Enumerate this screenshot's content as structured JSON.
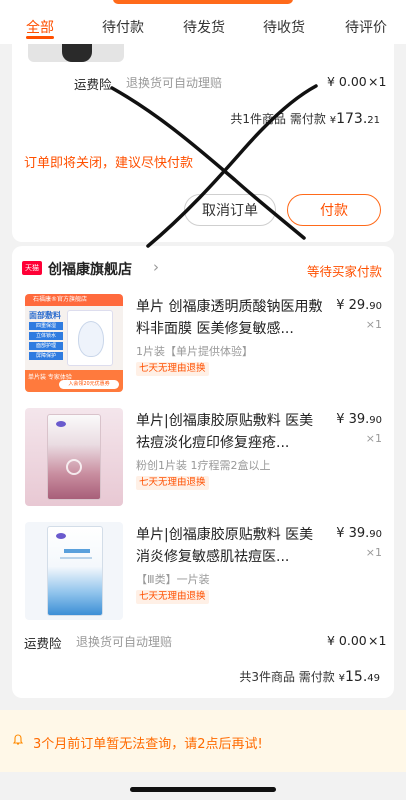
{
  "tabs": [
    {
      "label": "全部",
      "active": true
    },
    {
      "label": "待付款",
      "active": false
    },
    {
      "label": "待发货",
      "active": false
    },
    {
      "label": "待收货",
      "active": false
    },
    {
      "label": "待评价",
      "active": false
    }
  ],
  "order1": {
    "shipping_label": "运费险",
    "shipping_desc": "退换货可自动理赔",
    "shipping_price": "¥ 0.00",
    "shipping_qty": "×1",
    "summary_count": "共1件商品",
    "summary_pay_label": "需付款",
    "summary_currency": "¥",
    "summary_int": "173.",
    "summary_dec": "21",
    "notice": "订单即将关闭，建议尽快付款",
    "cancel_label": "取消订单",
    "pay_label": "付款"
  },
  "order2": {
    "store_badge": "天猫",
    "store_name": "创福康旗舰店",
    "store_status": "等待买家付款",
    "items": [
      {
        "title": "单片 创福康透明质酸钠医用敷料非面膜 医美修复敏感...",
        "sku": "1片装【单片提供体验】",
        "tag": "七天无理由退换",
        "price_int": "¥ 29.",
        "price_dec": "90",
        "qty": "×1",
        "img_band": "石福康®官方旗舰店",
        "img_title": "面部敷料",
        "img_lines": [
          "四重保湿",
          "立体锁水",
          "面部护理",
          "屏障保护"
        ],
        "img_bottom1": "单片装 专家体验",
        "img_bottom2": "入会领20元优惠券"
      },
      {
        "title": "单片|创福康胶原贴敷料 医美祛痘淡化痘印修复痤疮...",
        "sku": "粉创1片装 1疗程需2盒以上",
        "tag": "七天无理由退换",
        "price_int": "¥ 39.",
        "price_dec": "90",
        "qty": "×1"
      },
      {
        "title": "单片|创福康胶原贴敷料 医美消炎修复敏感肌祛痘医...",
        "sku": "【Ⅲ类】一片装",
        "tag": "七天无理由退换",
        "price_int": "¥ 39.",
        "price_dec": "90",
        "qty": "×1"
      }
    ],
    "shipping_label": "运费险",
    "shipping_desc": "退换货可自动理赔",
    "shipping_price": "¥ 0.00",
    "shipping_qty": "×1",
    "summary_count": "共3件商品",
    "summary_pay_label": "需付款",
    "summary_currency": "¥",
    "summary_int": "15.",
    "summary_dec": "49"
  },
  "bottom_notice": "3个月前订单暂无法查询，请2点后再试!",
  "colors": {
    "accent": "#ff5000",
    "tmall": "#ff0036",
    "notice_bg": "#fff8e8"
  }
}
